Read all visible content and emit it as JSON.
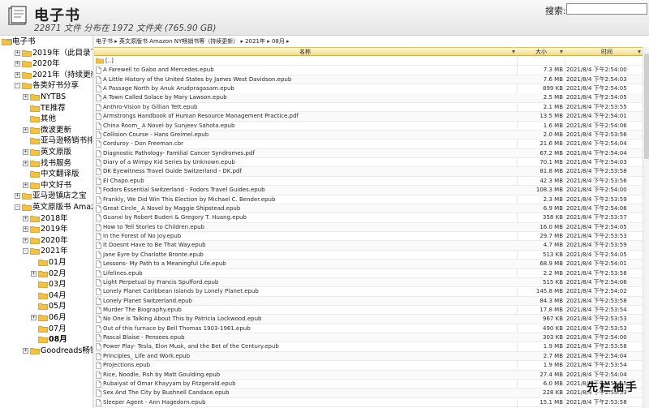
{
  "header": {
    "title": "电子书",
    "subtitle": "22871 文件 分布在 1972 文件夹 (765.90 GB)",
    "search_label": "搜索:",
    "search_value": ""
  },
  "sidebar": {
    "items": [
      {
        "label": "电子书",
        "level": 0,
        "toggle": "-"
      },
      {
        "label": "2019年（此目录下大",
        "level": 1,
        "toggle": "+"
      },
      {
        "label": "2020年",
        "level": 1,
        "toggle": "+"
      },
      {
        "label": "2021年（持续更新）",
        "level": 1,
        "toggle": "+"
      },
      {
        "label": "各类好书分享",
        "level": 1,
        "toggle": "-"
      },
      {
        "label": "NYTBS",
        "level": 2,
        "toggle": "+"
      },
      {
        "label": "TE推荐",
        "level": 2,
        "toggle": ""
      },
      {
        "label": "其他",
        "level": 2,
        "toggle": ""
      },
      {
        "label": "微波更新",
        "level": 2,
        "toggle": "+"
      },
      {
        "label": "亚马逊畅销书排行",
        "level": 2,
        "toggle": ""
      },
      {
        "label": "英文原版",
        "level": 2,
        "toggle": "+"
      },
      {
        "label": "找书服务",
        "level": 2,
        "toggle": "+"
      },
      {
        "label": "中文翻译版",
        "level": 2,
        "toggle": ""
      },
      {
        "label": "中文好书",
        "level": 2,
        "toggle": "+"
      },
      {
        "label": "亚马逊镇店之宝",
        "level": 1,
        "toggle": "+"
      },
      {
        "label": "英文原版书 Amazon",
        "level": 1,
        "toggle": "-"
      },
      {
        "label": "2018年",
        "level": 2,
        "toggle": "+"
      },
      {
        "label": "2019年",
        "level": 2,
        "toggle": "+"
      },
      {
        "label": "2020年",
        "level": 2,
        "toggle": "+"
      },
      {
        "label": "2021年",
        "level": 2,
        "toggle": "-"
      },
      {
        "label": "01月",
        "level": 3,
        "toggle": ""
      },
      {
        "label": "02月",
        "level": 3,
        "toggle": "+"
      },
      {
        "label": "03月",
        "level": 3,
        "toggle": ""
      },
      {
        "label": "04月",
        "level": 3,
        "toggle": ""
      },
      {
        "label": "05月",
        "level": 3,
        "toggle": ""
      },
      {
        "label": "06月",
        "level": 3,
        "toggle": "+"
      },
      {
        "label": "07月",
        "level": 3,
        "toggle": ""
      },
      {
        "label": "08月",
        "level": 3,
        "toggle": "",
        "bold": true
      },
      {
        "label": "Goodreads畅销书",
        "level": 2,
        "toggle": "+"
      }
    ]
  },
  "breadcrumb": "电子书 ▸ 英文原版书 Amazon NY畅销书等（持续更新） ▸ 2021年 ▸ 08月 ▸",
  "table": {
    "col_name": "名称",
    "col_size": "大小",
    "col_time": "时间",
    "parent_label": "[..]",
    "rows": [
      {
        "name": "A Farewell to Gabo and Mercedes.epub",
        "size": "7.3 MB",
        "time": "2021/8/4 下午2:54:00"
      },
      {
        "name": "A Little History of the United States by James West Davidson.epub",
        "size": "7.6 MB",
        "time": "2021/8/4 下午2:54:03"
      },
      {
        "name": "A Passage North by Anuk Arudpragasam.epub",
        "size": "899 KB",
        "time": "2021/8/4 下午2:54:05"
      },
      {
        "name": "A Town Called Solace by Mary Lawson.epub",
        "size": "2.5 MB",
        "time": "2021/8/4 下午2:54:05"
      },
      {
        "name": "Anthro-Vision by Gillian Tett.epub",
        "size": "2.1 MB",
        "time": "2021/8/4 下午2:53:55"
      },
      {
        "name": "Armstrongs Handbook of Human Resource Management Practice.pdf",
        "size": "13.5 MB",
        "time": "2021/8/4 下午2:54:01"
      },
      {
        "name": "China Room_ A Novel by Sunjeev Sahota.epub",
        "size": "1.6 MB",
        "time": "2021/8/4 下午2:54:06"
      },
      {
        "name": "Collision Course - Hans Greimel.epub",
        "size": "2.0 MB",
        "time": "2021/8/4 下午2:53:56"
      },
      {
        "name": "Corduroy - Don Freeman.cbr",
        "size": "21.6 MB",
        "time": "2021/8/4 下午2:54:04"
      },
      {
        "name": "Diagnostic Pathology- Familial Cancer Syndromes.pdf",
        "size": "67.2 MB",
        "time": "2021/8/4 下午2:54:04"
      },
      {
        "name": "Diary of a Wimpy Kid Series by Unknown.epub",
        "size": "70.1 MB",
        "time": "2021/8/4 下午2:54:03"
      },
      {
        "name": "DK Eyewitness Travel Guide Switzerland - DK.pdf",
        "size": "81.8 MB",
        "time": "2021/8/4 下午2:53:58"
      },
      {
        "name": "El Chapo.epub",
        "size": "42.3 MB",
        "time": "2021/8/4 下午2:53:56"
      },
      {
        "name": "Fodors Essential Switzerland - Fodors Travel Guides.epub",
        "size": "108.3 MB",
        "time": "2021/8/4 下午2:54:00"
      },
      {
        "name": "Frankly, We Did Win This Election by Michael C. Bender.epub",
        "size": "2.3 MB",
        "time": "2021/8/4 下午2:53:59"
      },
      {
        "name": "Great Circle_ A Novel by Maggie Shipstead.epub",
        "size": "6.9 MB",
        "time": "2021/8/4 下午2:54:06"
      },
      {
        "name": "Guanxi by Robert Buderi & Gregory T. Huang.epub",
        "size": "358 KB",
        "time": "2021/8/4 下午2:53:57"
      },
      {
        "name": "How to Tell Stories to Children.epub",
        "size": "16.0 MB",
        "time": "2021/8/4 下午2:54:05"
      },
      {
        "name": "In the Forest of No Joy.epub",
        "size": "29.7 MB",
        "time": "2021/8/4 下午2:53:53"
      },
      {
        "name": "It Doesnt Have to Be That Way.epub",
        "size": "4.7 MB",
        "time": "2021/8/4 下午2:53:59"
      },
      {
        "name": "Jane Eyre by Charlotte Bronte.epub",
        "size": "513 KB",
        "time": "2021/8/4 下午2:54:05"
      },
      {
        "name": "Lessons- My Path to a Meaningful Life.epub",
        "size": "68.9 MB",
        "time": "2021/8/4 下午2:54:01"
      },
      {
        "name": "Lifelines.epub",
        "size": "2.2 MB",
        "time": "2021/8/4 下午2:53:58"
      },
      {
        "name": "Light Perpetual by Francis Spufford.epub",
        "size": "515 KB",
        "time": "2021/8/4 下午2:54:06"
      },
      {
        "name": "Lonely Planet Caribbean Islands by Lonely Planet.epub",
        "size": "145.8 MB",
        "time": "2021/8/4 下午2:54:02"
      },
      {
        "name": "Lonely Planet Switzerland.epub",
        "size": "84.3 MB",
        "time": "2021/8/4 下午2:53:58"
      },
      {
        "name": "Murder The Biography.epub",
        "size": "17.8 MB",
        "time": "2021/8/4 下午2:53:54"
      },
      {
        "name": "No One Is Talking About This by Patricia Lockwood.epub",
        "size": "967 KB",
        "time": "2021/8/4 下午2:53:53"
      },
      {
        "name": "Out of this furnace by Bell Thomas 1903-1961.epub",
        "size": "490 KB",
        "time": "2021/8/4 下午2:53:53"
      },
      {
        "name": "Pascal Blaise - Pensees.epub",
        "size": "303 KB",
        "time": "2021/8/4 下午2:54:00"
      },
      {
        "name": "Power Play- Tesla, Elon Musk, and the Bet of the Century.epub",
        "size": "1.9 MB",
        "time": "2021/8/4 下午2:53:58"
      },
      {
        "name": "Principles_ Life and Work.epub",
        "size": "2.7 MB",
        "time": "2021/8/4 下午2:54:04"
      },
      {
        "name": "Projections.epub",
        "size": "1.9 MB",
        "time": "2021/8/4 下午2:53:54"
      },
      {
        "name": "Rice, Noodle, Fish by Matt Goulding.epub",
        "size": "27.4 MB",
        "time": "2021/8/4 下午2:54:04"
      },
      {
        "name": "Rubaiyat of Omar Khayyam by Fitzgerald.epub",
        "size": "6.0 MB",
        "time": "2021/8/4 下午2:54:05"
      },
      {
        "name": "Sex And The City by Bushnell Candace.epub",
        "size": "228 KB",
        "time": "2021/8/4 下午2:53:53"
      },
      {
        "name": "Sleeper Agent - Ann Hagedorn.epub",
        "size": "15.1 MB",
        "time": "2021/8/4 下午2:53:58"
      }
    ]
  },
  "watermark": "先栏袖手",
  "colors": {
    "folder": "#f0c24a",
    "folder_dark": "#c89520",
    "header_bar": "#f1dc88"
  }
}
